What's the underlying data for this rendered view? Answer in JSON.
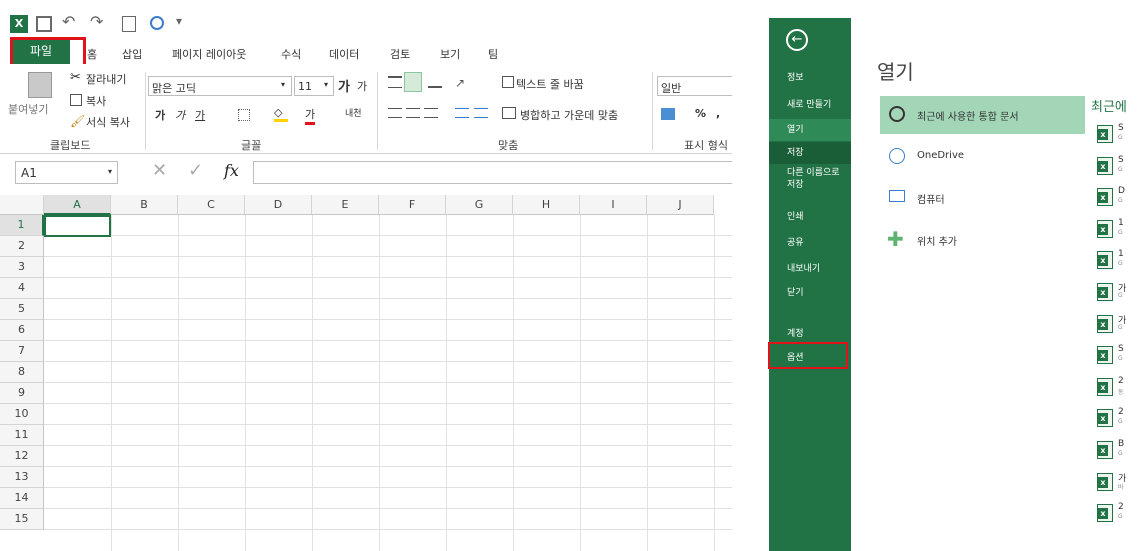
{
  "qat": {
    "excel_logo": "X",
    "save": "save-icon",
    "undo": "↶",
    "redo": "↷",
    "customize": "▾"
  },
  "tabs": {
    "file": "파일",
    "items": [
      "홈",
      "삽입",
      "페이지 레이아웃",
      "수식",
      "데이터",
      "검토",
      "보기",
      "팀"
    ]
  },
  "clipboard": {
    "paste": "붙여넣기",
    "cut": "잘라내기",
    "copy": "복사",
    "format": "서식 복사",
    "group": "클립보드"
  },
  "font": {
    "name": "맑은 고딕",
    "size": "11",
    "grow": "가",
    "shrink": "가",
    "bold": "가",
    "italic": "가",
    "underline": "가",
    "color_a": "가",
    "phonetic": "내천",
    "group": "글꼴"
  },
  "alignment": {
    "wrap": "텍스트 줄 바꿈",
    "merge": "병합하고 가운데 맞춤",
    "group": "맞춤"
  },
  "number": {
    "format": "일반",
    "percent": "%",
    "comma": ",",
    "group": "표시 형식"
  },
  "formula_bar": {
    "name_box": "A1",
    "fx": "fx"
  },
  "columns": [
    "A",
    "B",
    "C",
    "D",
    "E",
    "F",
    "G",
    "H",
    "I",
    "J"
  ],
  "rows": [
    "1",
    "2",
    "3",
    "4",
    "5",
    "6",
    "7",
    "8",
    "9",
    "10",
    "11",
    "12",
    "13",
    "14",
    "15"
  ],
  "backstage": {
    "back": "←",
    "nav": [
      "정보",
      "새로 만들기",
      "열기",
      "저장",
      "다른 이름으로",
      "저장",
      "인쇄",
      "공유",
      "내보내기",
      "닫기",
      "계정",
      "옵션"
    ],
    "title": "열기",
    "places": [
      "최근에 사용한 통합 문서",
      "OneDrive",
      "컴퓨터",
      "위치 추가"
    ],
    "recent_header": "최근에",
    "recent_items": [
      {
        "l": "S",
        "s": "G"
      },
      {
        "l": "S",
        "s": "G"
      },
      {
        "l": "D",
        "s": "G"
      },
      {
        "l": "1",
        "s": "G"
      },
      {
        "l": "1",
        "s": "G"
      },
      {
        "l": "가",
        "s": "G"
      },
      {
        "l": "가",
        "s": "G"
      },
      {
        "l": "S",
        "s": "G"
      },
      {
        "l": "2",
        "s": "동"
      },
      {
        "l": "2",
        "s": "G"
      },
      {
        "l": "B",
        "s": "G"
      },
      {
        "l": "가",
        "s": "바"
      },
      {
        "l": "2",
        "s": "G"
      }
    ]
  },
  "colors": {
    "accent": "#217346",
    "selected_place": "#a3d6b7",
    "highlight": "#e0131a"
  }
}
